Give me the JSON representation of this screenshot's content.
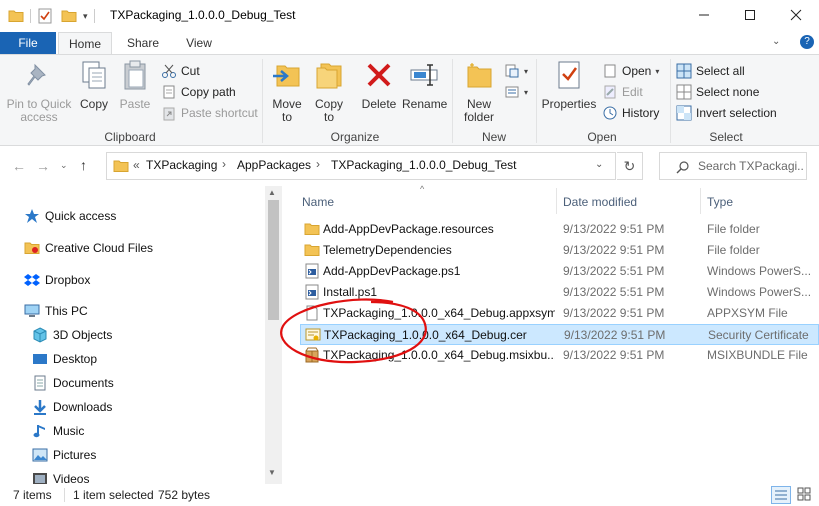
{
  "window": {
    "title": "TXPackaging_1.0.0.0_Debug_Test",
    "minimize_icon": "minimize-icon",
    "maximize_icon": "maximize-icon",
    "close_icon": "close-icon",
    "help_label": "?"
  },
  "tabs": [
    {
      "label": "File"
    },
    {
      "label": "Home"
    },
    {
      "label": "Share"
    },
    {
      "label": "View"
    }
  ],
  "ribbon": {
    "clipboard": {
      "pin_label": "Pin to Quick access",
      "copy_label": "Copy",
      "paste_label": "Paste",
      "cut_label": "Cut",
      "copy_path_label": "Copy path",
      "paste_shortcut_label": "Paste shortcut",
      "group_label": "Clipboard"
    },
    "organize": {
      "move_to_label": "Move to",
      "copy_to_label": "Copy to",
      "delete_label": "Delete",
      "rename_label": "Rename",
      "group_label": "Organize"
    },
    "new": {
      "new_folder_label": "New folder",
      "group_label": "New"
    },
    "open": {
      "properties_label": "Properties",
      "open_label": "Open",
      "edit_label": "Edit",
      "history_label": "History",
      "group_label": "Open"
    },
    "select": {
      "select_all_label": "Select all",
      "select_none_label": "Select none",
      "invert_selection_label": "Invert selection",
      "group_label": "Select"
    }
  },
  "address": {
    "overflow": "«",
    "crumbs": [
      "TXPackaging",
      "AppPackages",
      "TXPackaging_1.0.0.0_Debug_Test"
    ],
    "search_placeholder": "Search TXPackagi..."
  },
  "nav": {
    "items": [
      {
        "label": "Quick access",
        "icon": "star-icon"
      },
      {
        "label": "Creative Cloud Files",
        "icon": "cc-folder-icon"
      },
      {
        "label": "Dropbox",
        "icon": "dropbox-icon"
      },
      {
        "label": "This PC",
        "icon": "computer-icon"
      },
      {
        "label": "3D Objects",
        "icon": "cube-icon"
      },
      {
        "label": "Desktop",
        "icon": "desktop-icon"
      },
      {
        "label": "Documents",
        "icon": "documents-icon"
      },
      {
        "label": "Downloads",
        "icon": "download-icon"
      },
      {
        "label": "Music",
        "icon": "music-icon"
      },
      {
        "label": "Pictures",
        "icon": "pictures-icon"
      },
      {
        "label": "Videos",
        "icon": "videos-icon"
      }
    ]
  },
  "files": {
    "columns": [
      "Name",
      "Date modified",
      "Type"
    ],
    "rows": [
      {
        "name": "Add-AppDevPackage.resources",
        "date": "9/13/2022 9:51 PM",
        "type": "File folder",
        "icon": "folder-icon"
      },
      {
        "name": "TelemetryDependencies",
        "date": "9/13/2022 9:51 PM",
        "type": "File folder",
        "icon": "folder-icon"
      },
      {
        "name": "Add-AppDevPackage.ps1",
        "date": "9/13/2022 5:51 PM",
        "type": "Windows PowerS...",
        "icon": "powershell-file-icon"
      },
      {
        "name": "Install.ps1",
        "date": "9/13/2022 5:51 PM",
        "type": "Windows PowerS...",
        "icon": "powershell-file-icon"
      },
      {
        "name": "TXPackaging_1.0.0.0_x64_Debug.appxsym",
        "date": "9/13/2022 9:51 PM",
        "type": "APPXSYM File",
        "icon": "blank-file-icon"
      },
      {
        "name": "TXPackaging_1.0.0.0_x64_Debug.cer",
        "date": "9/13/2022 9:51 PM",
        "type": "Security Certificate",
        "icon": "certificate-icon",
        "selected": true
      },
      {
        "name": "TXPackaging_1.0.0.0_x64_Debug.msixbu...",
        "date": "9/13/2022 9:51 PM",
        "type": "MSIXBUNDLE File",
        "icon": "package-icon"
      }
    ]
  },
  "status": {
    "items_count": "7 items",
    "selected": "1 item selected",
    "size": "752 bytes"
  },
  "colors": {
    "accent": "#1a64b4",
    "selection": "#cce8ff",
    "annotation": "#e01010"
  }
}
